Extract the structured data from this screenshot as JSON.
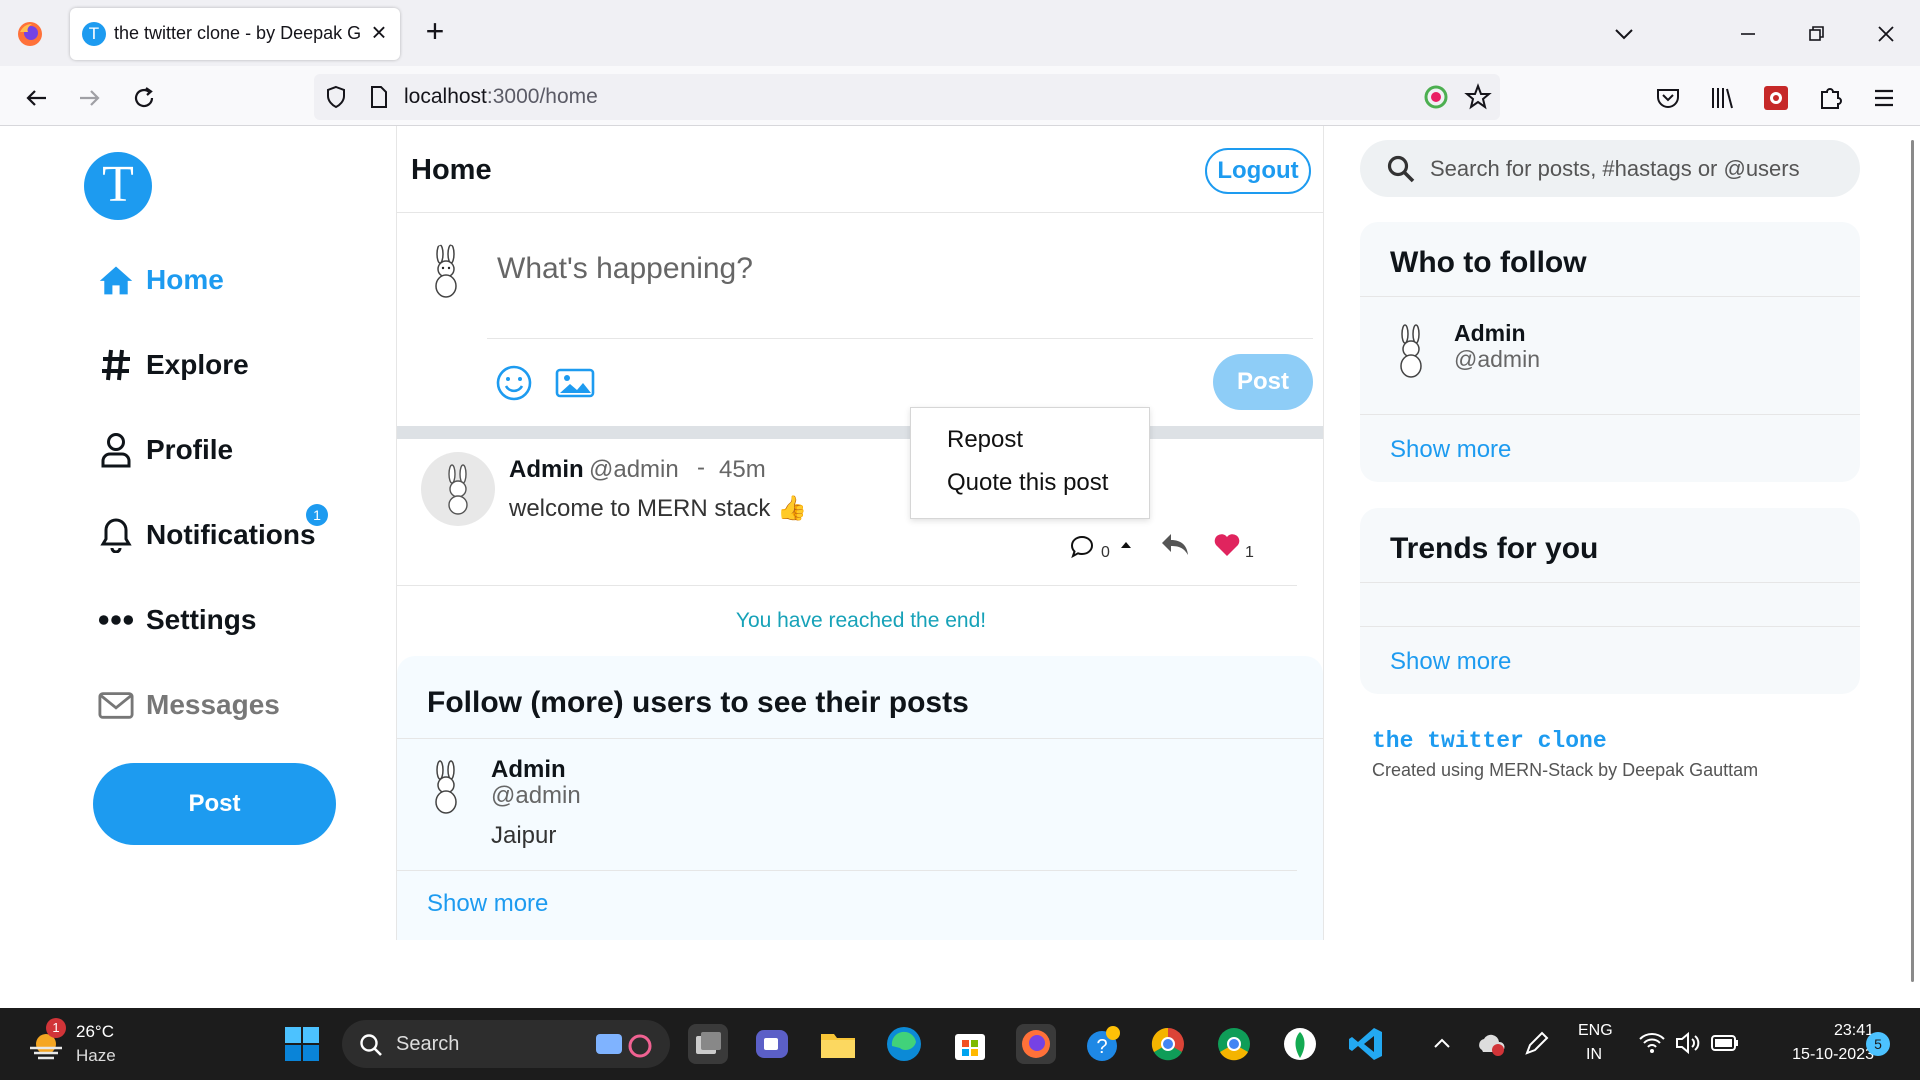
{
  "browser": {
    "tab_title": "the twitter clone - by Deepak Gauttam",
    "url_host": "localhost",
    "url_path": ":3000/home",
    "tab_favicon_letter": "T"
  },
  "sidebar": {
    "logo_letter": "T",
    "items": [
      {
        "label": "Home",
        "icon": "home-icon"
      },
      {
        "label": "Explore",
        "icon": "hashtag-icon"
      },
      {
        "label": "Profile",
        "icon": "user-icon"
      },
      {
        "label": "Notifications",
        "icon": "bell-icon"
      },
      {
        "label": "Settings",
        "icon": "ellipsis-icon"
      },
      {
        "label": "Messages",
        "icon": "envelope-icon"
      }
    ],
    "notification_count": "1",
    "post_button": "Post"
  },
  "header": {
    "title": "Home",
    "logout_label": "Logout"
  },
  "composer": {
    "placeholder": "What's happening?",
    "post_button": "Post"
  },
  "feed": {
    "posts": [
      {
        "name": "Admin",
        "handle": "@admin",
        "separator": "-",
        "time": "45m",
        "text": "welcome to MERN stack 👍",
        "comments": "0",
        "likes": "1"
      }
    ],
    "end_message": "You have reached the end!"
  },
  "repost_menu": {
    "items": [
      "Repost",
      "Quote this post"
    ]
  },
  "follow_more": {
    "title": "Follow (more) users to see their posts",
    "user": {
      "name": "Admin",
      "handle": "@admin",
      "location": "Jaipur"
    },
    "show_more": "Show more"
  },
  "right": {
    "search_placeholder": "Search for posts, #hastags or @users",
    "who_to_follow": {
      "title": "Who to follow",
      "user": {
        "name": "Admin",
        "handle": "@admin"
      },
      "show_more": "Show more"
    },
    "trends": {
      "title": "Trends for you",
      "show_more": "Show more"
    },
    "footer": {
      "title": "the twitter clone",
      "subtitle": "Created using MERN-Stack by Deepak Gauttam"
    }
  },
  "taskbar": {
    "weather_temp": "26°C",
    "weather_desc": "Haze",
    "weather_badge": "1",
    "search_label": "Search",
    "language_top": "ENG",
    "language_bottom": "IN",
    "time": "23:41",
    "date": "15-10-2023",
    "notification_count": "5"
  },
  "colors": {
    "accent": "#1d9bf0",
    "end_message": "#17a2b8",
    "like": "#e0245e"
  }
}
